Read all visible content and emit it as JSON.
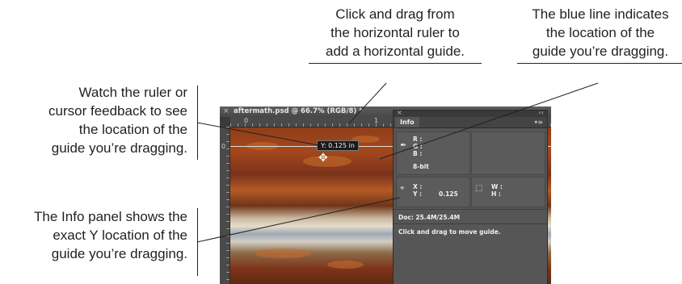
{
  "callouts": {
    "top_left": [
      "Click and drag from",
      "the horizontal ruler to",
      "add a horizontal guide."
    ],
    "top_right": [
      "The blue line indicates",
      "the location of the",
      "guide you’re dragging."
    ],
    "left_top": [
      "Watch the ruler or",
      "cursor feedback to see",
      "the location of the",
      "guide you’re dragging."
    ],
    "left_bottom": [
      "The Info panel shows the",
      "exact Y location of the",
      "guide you’re dragging."
    ]
  },
  "window": {
    "title": "aftermath.psd @ 66.7% (RGB/8) *",
    "close_glyph": "×",
    "ruler_h": [
      "0",
      "1"
    ],
    "ruler_v": [
      "0"
    ]
  },
  "tooltip": "Y: 0.125 in",
  "info_panel": {
    "close_glyph": "×",
    "collapse_glyph": "‹‹",
    "tab": "Info",
    "menu_glyph": "▾≡",
    "rgb": {
      "r": "R :",
      "g": "G :",
      "b": "B :"
    },
    "bit_depth": "8-bit",
    "x_label": "X :",
    "y_label": "Y :",
    "y_value": "0.125",
    "w_label": "W :",
    "h_label": "H :",
    "doc": "Doc: 25.4M/25.4M",
    "hint": "Click and drag to move guide."
  },
  "colors": {
    "guide": "#dcdcdc",
    "panel_bg": "#565656",
    "callout_text": "#231f20"
  }
}
